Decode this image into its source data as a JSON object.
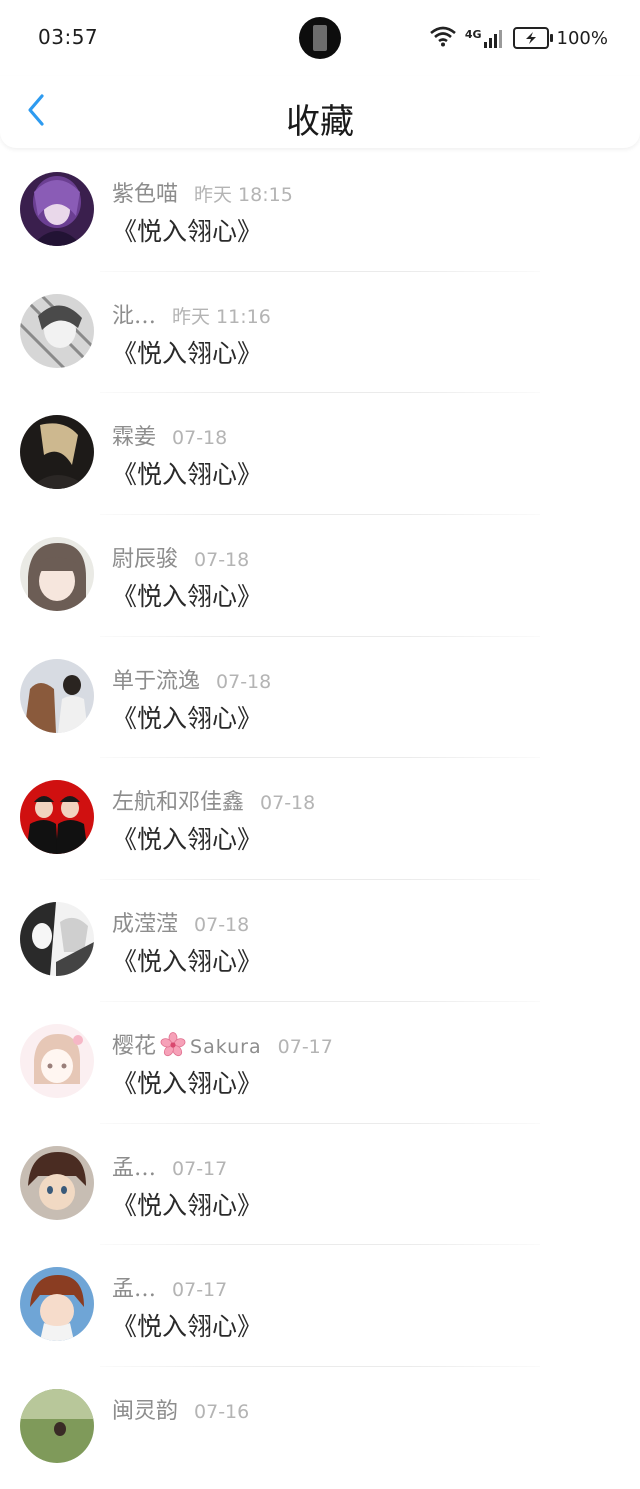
{
  "status_bar": {
    "time": "03:57",
    "battery": "100%",
    "network": "4G",
    "icons": [
      "wifi-icon",
      "signal-icon",
      "battery-charging-icon"
    ]
  },
  "header": {
    "title": "收藏",
    "back_icon": "chevron-left-icon"
  },
  "colors": {
    "accent": "#2e9bf0",
    "author_text": "#8d8d8d",
    "timestamp_text": "#b4b4b4",
    "title_text": "#2a2a2a"
  },
  "items": [
    {
      "author": "紫色喵",
      "time": "昨天 18:15",
      "title": "《悦入翎心》"
    },
    {
      "author": "沘…",
      "time": "昨天 11:16",
      "title": "《悦入翎心》"
    },
    {
      "author": "霖姜",
      "time": "07-18",
      "title": "《悦入翎心》"
    },
    {
      "author": "尉辰骏",
      "time": "07-18",
      "title": "《悦入翎心》"
    },
    {
      "author": "单于流逸",
      "time": "07-18",
      "title": "《悦入翎心》"
    },
    {
      "author": "左航和邓佳鑫",
      "time": "07-18",
      "title": "《悦入翎心》"
    },
    {
      "author": "成滢滢",
      "time": "07-18",
      "title": "《悦入翎心》"
    },
    {
      "author": "樱花",
      "author_suffix": "Sakura",
      "time": "07-17",
      "title": "《悦入翎心》"
    },
    {
      "author": "孟…",
      "time": "07-17",
      "title": "《悦入翎心》"
    },
    {
      "author": "孟…",
      "time": "07-17",
      "title": "《悦入翎心》"
    },
    {
      "author": "闽灵韵",
      "time": "07-16",
      "title": ""
    }
  ]
}
